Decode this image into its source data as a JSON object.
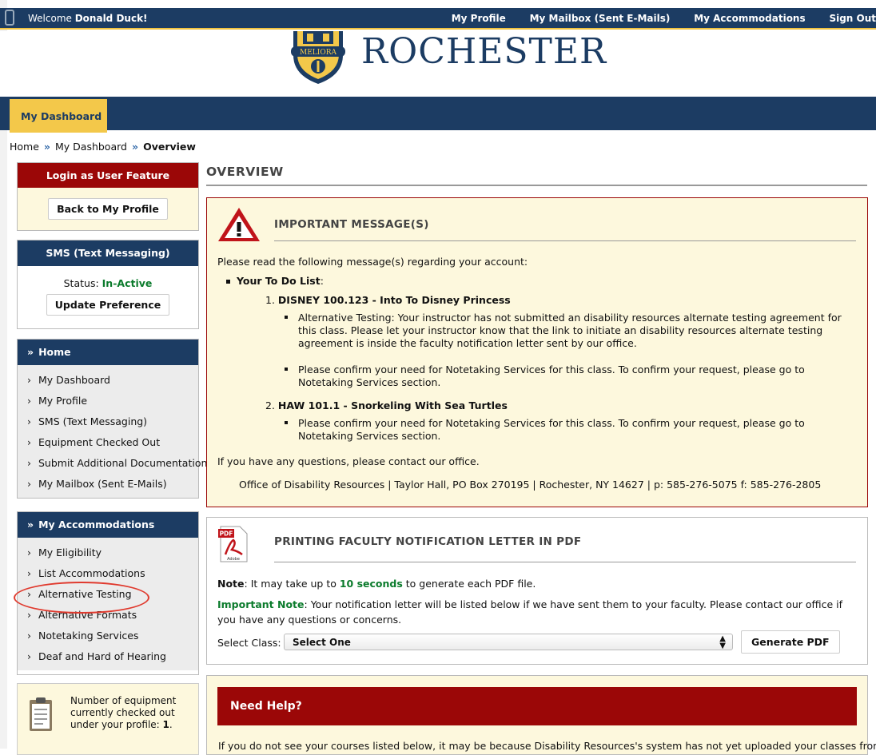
{
  "topbar": {
    "welcome_prefix": "Welcome ",
    "user_name": "Donald Duck!",
    "links": [
      "My Profile",
      "My Mailbox (Sent E-Mails)",
      "My Accommodations",
      "Sign Out"
    ]
  },
  "header": {
    "brand": "ROCHESTER",
    "seal_motto": "MELIORA"
  },
  "nav": {
    "tab": "My Dashboard"
  },
  "breadcrumb": {
    "home": "Home",
    "sep": "»",
    "dashboard": "My Dashboard",
    "current": "Overview"
  },
  "sidebar": {
    "login_feature": {
      "title": "Login as User Feature",
      "button": "Back to My Profile"
    },
    "sms": {
      "title": "SMS (Text Messaging)",
      "status_label": "Status:",
      "status_value": "In-Active",
      "button": "Update Preference"
    },
    "home_menu": {
      "title": "Home",
      "items": [
        "My Dashboard",
        "My Profile",
        "SMS (Text Messaging)",
        "Equipment Checked Out",
        "Submit Additional Documentation",
        "My Mailbox (Sent E-Mails)"
      ]
    },
    "accommodations_menu": {
      "title": "My Accommodations",
      "items": [
        "My Eligibility",
        "List Accommodations",
        "Alternative Testing",
        "Alternative Formats",
        "Notetaking Services",
        "Deaf and Hard of Hearing"
      ]
    },
    "equipment_box": {
      "text": "Number of equipment currently checked out under your profile:",
      "count": "1",
      "period": "."
    }
  },
  "main": {
    "title": "OVERVIEW",
    "important": {
      "heading": "IMPORTANT MESSAGE(S)",
      "intro": "Please read the following message(s) regarding your account:",
      "todo_label": "Your To Do List",
      "todo_colon": ":",
      "courses": [
        {
          "num": "1.",
          "name": "DISNEY 100.123 - Into To Disney Princess",
          "notes": [
            "Alternative Testing: Your instructor has not submitted an disability resources alternate testing agreement for this class. Please let your instructor know that the link to initiate an disability resources alternate testing agreement is inside the faculty notification letter sent by our office.",
            "Please confirm your need for Notetaking Services for this class. To confirm your request, please go to Notetaking Services section."
          ]
        },
        {
          "num": "2.",
          "name": "HAW 101.1 - Snorkeling With Sea Turtles",
          "notes": [
            "Please confirm your need for Notetaking Services for this class. To confirm your request, please go to Notetaking Services section."
          ]
        }
      ],
      "questions": "If you have any questions, please contact our office.",
      "contact": "Office of Disability Resources | Taylor Hall, PO Box 270195 | Rochester, NY 14627 | p: 585-276-5075 f: 585-276-2805"
    },
    "pdf": {
      "heading": "PRINTING FACULTY NOTIFICATION LETTER IN PDF",
      "icon_label": "PDF",
      "icon_brand": "Adobe",
      "note_label": "Note",
      "note_text_a": ": It may take up to ",
      "note_highlight": "10 seconds",
      "note_text_b": " to generate each PDF file.",
      "important_label": "Important Note",
      "important_text": ": Your notification letter will be listed below if we have sent them to your faculty. Please contact our office if you have any questions or concerns.",
      "select_label": "Select Class:",
      "select_value": "Select One",
      "button": "Generate PDF"
    },
    "help": {
      "heading": "Need Help?",
      "text": "If you do not see your courses listed below, it may be because Disability Resources's system has not yet uploaded your classes from the"
    }
  },
  "colors": {
    "navy": "#1c3c63",
    "gold": "#f3c84a",
    "crimson": "#9b0707",
    "cream": "#fdf8dd",
    "green": "#0b7b2c",
    "annotation": "#e03a2e"
  }
}
